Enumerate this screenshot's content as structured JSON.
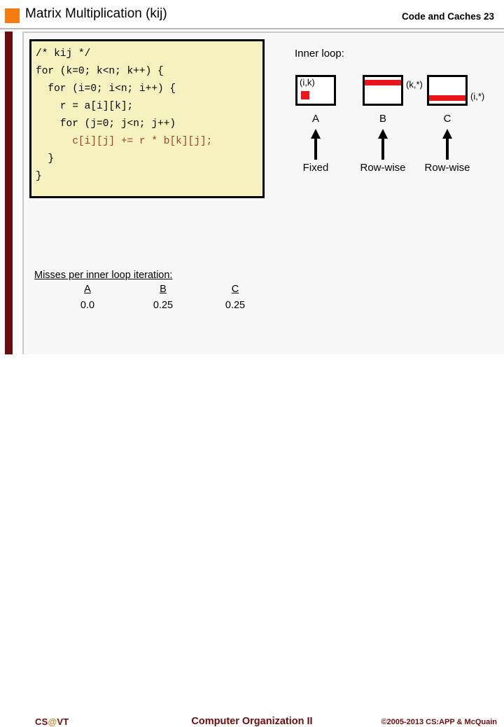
{
  "header": {
    "title": "Matrix Multiplication (kij)",
    "right_label": "Code and Caches  23",
    "accent_color": "#F47B10"
  },
  "code": {
    "language": "c",
    "background_color": "#F5F2C0",
    "accent_text_color": "#A04020",
    "lines": [
      "/* kij */",
      "for (k=0; k<n; k++) {",
      "  for (i=0; i<n; i++) {",
      "    r = a[i][k];",
      "    for (j=0; j<n; j++)",
      "      c[i][j] += r * b[k][j];",
      "  }",
      "}"
    ],
    "plain_prefix": "/* kij */\nfor (k=0; k<n; k++) {\n  for (i=0; i<n; i++) {\n    r = a[i][k];\n    for (j=0; j<n; j++)\n      ",
    "highlighted_line": "c[i][j] += r * b[k][j];",
    "plain_suffix": "\n  }\n}"
  },
  "inner_loop": {
    "label": "Inner loop:",
    "highlight_color": "#E8161A",
    "matrices": [
      {
        "name": "A",
        "coord_label": "(i,k)",
        "coord_position": "inside",
        "access_pattern": "Fixed",
        "marker": "cell"
      },
      {
        "name": "B",
        "coord_label": "(k,*)",
        "coord_position": "right",
        "access_pattern": "Row-wise",
        "marker": "row-top"
      },
      {
        "name": "C",
        "coord_label": "(i,*)",
        "coord_position": "right",
        "access_pattern": "Row-wise",
        "marker": "row-bottom"
      }
    ]
  },
  "misses": {
    "title": "Misses per inner loop iteration:",
    "columns": [
      "A",
      "B",
      "C"
    ],
    "values": [
      "0.0",
      "0.25",
      "0.25"
    ]
  },
  "footer": {
    "brand_prefix": "CS",
    "brand_at": "@",
    "brand_suffix": "VT",
    "center": "Computer Organization II",
    "copyright": "©2005-2013 CS:APP & McQuain",
    "color": "#6B0D0D"
  }
}
